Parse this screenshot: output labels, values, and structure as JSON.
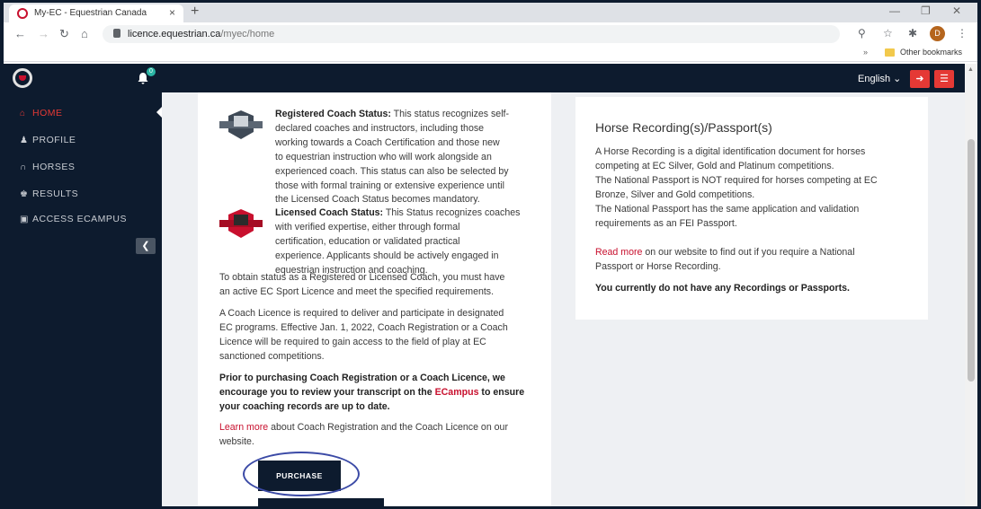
{
  "browser": {
    "tab_title": "My-EC - Equestrian Canada",
    "tab_close": "×",
    "new_tab": "+",
    "url_domain": "licence.equestrian.ca",
    "url_path": "/myec/home",
    "profile_initial": "D",
    "bookmarks_chevron": "»",
    "bookmarks_other": "Other bookmarks"
  },
  "header": {
    "notification_count": "0",
    "language": "English ⌄"
  },
  "sidebar": {
    "items": [
      {
        "label": "HOME",
        "icon": "home-icon"
      },
      {
        "label": "PROFILE",
        "icon": "user-icon"
      },
      {
        "label": "HORSES",
        "icon": "horseshoe-icon"
      },
      {
        "label": "RESULTS",
        "icon": "trophy-icon"
      },
      {
        "label": "ACCESS ECAMPUS",
        "icon": "book-icon"
      }
    ]
  },
  "coach": {
    "registered_title": "Registered Coach Status:",
    "registered_line1": " This status recognizes self-",
    "registered_lines": [
      "declared coaches and instructors, including those",
      "working towards a Coach Certification and those new",
      "to equestrian instruction who will work alongside an",
      "experienced coach. This status can also be selected by",
      "those with formal training or extensive experience until",
      "the Licensed Coach Status becomes mandatory."
    ],
    "licensed_title": "Licensed Coach Status:",
    "licensed_line1": " This Status recognizes coaches",
    "licensed_lines": [
      "with verified expertise, either through formal",
      "certification, education or validated practical",
      "experience. Applicants should be actively engaged in",
      "equestrian instruction and coaching."
    ],
    "obtain_lines": [
      "To obtain status as a Registered or Licensed Coach, you must have",
      "an active EC Sport Licence and meet the specified requirements."
    ],
    "licence_lines": [
      "A Coach Licence is required to deliver and participate in designated",
      "EC programs. Effective Jan. 1, 2022, Coach Registration or a Coach",
      "Licence will be required to gain access to the field of play at EC",
      "sanctioned competitions."
    ],
    "prior_line1": "Prior to purchasing Coach Registration or a Coach Licence, we",
    "prior_line2a": "encourage you to review your transcript on the ",
    "prior_link": "ECampus",
    "prior_line2b": " to ensure",
    "prior_line3": "your coaching records are up to date.",
    "learn_link": "Learn more",
    "learn_rest": " about Coach Registration and the Coach Licence on our",
    "learn_line2": "website.",
    "purchase_label": "PURCHASE"
  },
  "horse": {
    "title": "Horse Recording(s)/Passport(s)",
    "desc_lines": [
      "A Horse Recording is a digital identification document for horses",
      "competing at EC Silver, Gold and Platinum competitions.",
      "The National Passport is NOT required for horses competing at EC",
      "Bronze, Silver and Gold competitions.",
      "The National Passport has the same application and validation",
      "requirements as an FEI Passport."
    ],
    "read_link": "Read more",
    "read_rest": " on our website to find out if you require a National",
    "read_line2": "Passport or Horse Recording.",
    "none_text": "You currently do not have any Recordings or Passports."
  },
  "colors": {
    "navy": "#0d1b2e",
    "accent_red": "#e53935",
    "link_red": "#c8102e",
    "highlight_circle": "#3b4aa6"
  }
}
